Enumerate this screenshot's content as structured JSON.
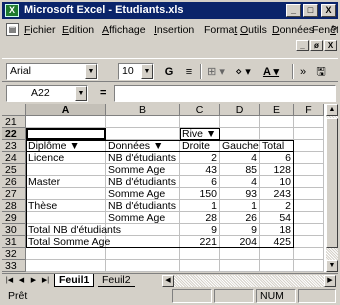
{
  "window": {
    "title": "Microsoft Excel - Etudiants.xls",
    "app_icon": "excel-icon",
    "buttons": [
      "_",
      "□",
      "X"
    ]
  },
  "menu": {
    "doc_icon": "document-icon",
    "items": [
      {
        "u": "F",
        "rest": "ichier"
      },
      {
        "u": "E",
        "rest": "dition"
      },
      {
        "u": "A",
        "rest": "ffichage"
      },
      {
        "u": "I",
        "rest": "nsertion"
      },
      {
        "pre": "Forma",
        "u": "t",
        "rest": ""
      },
      {
        "u": "O",
        "rest": "utils"
      },
      {
        "u": "D",
        "rest": "onnées"
      },
      {
        "pre": "Fen",
        "u": "ê",
        "rest": "tre"
      },
      {
        "u": "?",
        "rest": ""
      }
    ],
    "doc_buttons": [
      "_",
      "ø",
      "X"
    ]
  },
  "toolbar": {
    "font": "Arial",
    "size": "10",
    "bold": "G",
    "align": "≡",
    "borders": "⊞",
    "fill": "⋄",
    "fontcolor": "A",
    "more": "»",
    "save": "🖫"
  },
  "formula": {
    "name_box": "A22",
    "equals": "=",
    "value": ""
  },
  "grid": {
    "columns": [
      "A",
      "B",
      "C",
      "D",
      "E",
      "F"
    ],
    "active_column": "A",
    "active_row": "22",
    "rows": [
      {
        "n": "21",
        "cells": [
          "",
          "",
          "",
          "",
          "",
          ""
        ]
      },
      {
        "n": "22",
        "cells": [
          "",
          "",
          "Rive ▼",
          "",
          "",
          ""
        ]
      },
      {
        "n": "23",
        "cells": [
          "Diplôme ▼",
          "Données ▼",
          "Droite",
          "Gauche",
          "Total",
          ""
        ]
      },
      {
        "n": "24",
        "cells": [
          "Licence",
          "NB d'étudiants",
          "2",
          "4",
          "6",
          ""
        ]
      },
      {
        "n": "25",
        "cells": [
          "",
          "Somme Age",
          "43",
          "85",
          "128",
          ""
        ]
      },
      {
        "n": "26",
        "cells": [
          "Master",
          "NB d'étudiants",
          "6",
          "4",
          "10",
          ""
        ]
      },
      {
        "n": "27",
        "cells": [
          "",
          "Somme Age",
          "150",
          "93",
          "243",
          ""
        ]
      },
      {
        "n": "28",
        "cells": [
          "Thèse",
          "NB d'étudiants",
          "1",
          "1",
          "2",
          ""
        ]
      },
      {
        "n": "29",
        "cells": [
          "",
          "Somme Age",
          "28",
          "26",
          "54",
          ""
        ]
      },
      {
        "n": "30",
        "cells": [
          "Total NB d'étudiants",
          "",
          "9",
          "9",
          "18",
          ""
        ]
      },
      {
        "n": "31",
        "cells": [
          "Total Somme Age",
          "",
          "221",
          "204",
          "425",
          ""
        ]
      },
      {
        "n": "32",
        "cells": [
          "",
          "",
          "",
          "",
          "",
          ""
        ]
      },
      {
        "n": "33",
        "cells": [
          "",
          "",
          "",
          "",
          "",
          ""
        ]
      }
    ]
  },
  "sheets": {
    "tabs": [
      "Feuil1",
      "Feuil2"
    ],
    "active": "Feuil1"
  },
  "status": {
    "ready": "Prêt",
    "num": "NUM"
  }
}
